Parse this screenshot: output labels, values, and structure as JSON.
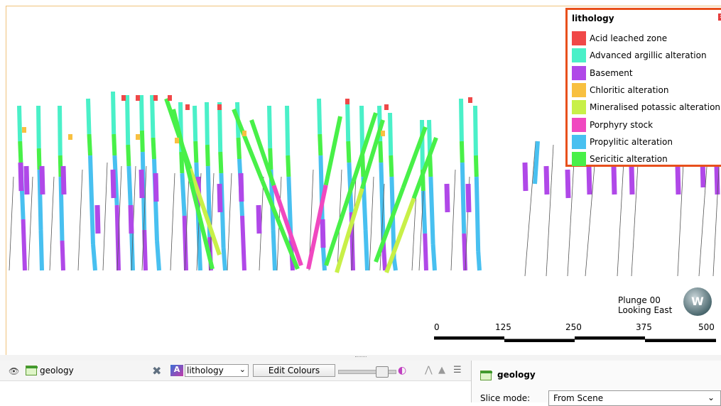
{
  "legend": {
    "title": "lithology",
    "items": [
      {
        "label": "Acid leached zone",
        "color": "#f04848"
      },
      {
        "label": "Advanced argillic alteration",
        "color": "#4af0c8"
      },
      {
        "label": "Basement",
        "color": "#b048e8"
      },
      {
        "label": "Chloritic alteration",
        "color": "#f8c040"
      },
      {
        "label": "Mineralised potassic alteration",
        "color": "#c8f048"
      },
      {
        "label": "Porphyry stock",
        "color": "#f048c0"
      },
      {
        "label": "Propylitic alteration",
        "color": "#48c0f0"
      },
      {
        "label": "Sericitic alteration",
        "color": "#48f048"
      }
    ]
  },
  "view": {
    "plunge": "Plunge 00",
    "looking": "Looking East"
  },
  "scale_bar": {
    "ticks": [
      "0",
      "125",
      "250",
      "375",
      "500"
    ]
  },
  "toolbar": {
    "object_name": "geology",
    "colour_by": "lithology",
    "edit_colours_label": "Edit Colours"
  },
  "properties": {
    "title": "geology",
    "slice_mode_label": "Slice mode:",
    "slice_mode_value": "From Scene"
  }
}
